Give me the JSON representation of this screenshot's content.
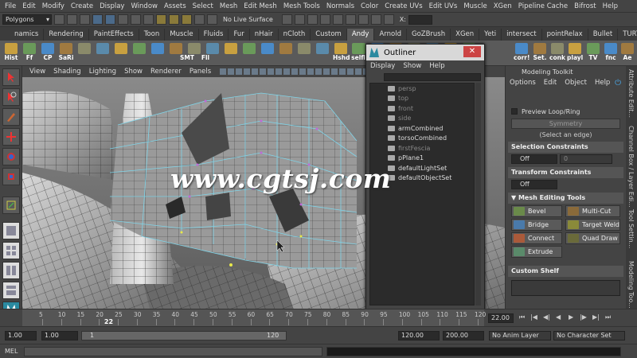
{
  "menubar": {
    "items": [
      "File",
      "Edit",
      "Modify",
      "Create",
      "Display",
      "Window",
      "Assets",
      "Select",
      "Mesh",
      "Edit Mesh",
      "Mesh Tools",
      "Normals",
      "Color",
      "Create UVs",
      "Edit UVs",
      "Muscle",
      "XGen",
      "Pipeline Cache",
      "Bifrost",
      "Help"
    ]
  },
  "statusline": {
    "mode": "Polygons",
    "live_surface": "No Live Surface",
    "x_label": "X:"
  },
  "shelf_tabs": [
    "namics",
    "Rendering",
    "PaintEffects",
    "Toon",
    "Muscle",
    "Fluids",
    "Fur",
    "nHair",
    "nCloth",
    "Custom",
    "Andy",
    "Arnold",
    "GoZBrush",
    "XGen",
    "Yeti",
    "intersect",
    "pointRelax",
    "Bullet",
    "TURTLE"
  ],
  "shelf_active_tab": "Andy",
  "shelf_tools_left": [
    "Hist",
    "Ff",
    "CP",
    "SaRi",
    "SMT",
    "Fll"
  ],
  "shelf_tools_right": [
    "Hshd",
    "selfl",
    "corr!",
    "Set.",
    "conk",
    "playl",
    "TV",
    "fnc",
    "Ae"
  ],
  "viewport": {
    "menu": [
      "View",
      "Shading",
      "Lighting",
      "Show",
      "Renderer",
      "Panels"
    ]
  },
  "outliner": {
    "title": "Outliner",
    "menu": [
      "Display",
      "Show",
      "Help"
    ],
    "items": [
      {
        "label": "persp",
        "dim": true
      },
      {
        "label": "top",
        "dim": true
      },
      {
        "label": "front",
        "dim": true
      },
      {
        "label": "side",
        "dim": true
      },
      {
        "label": "armCombined",
        "dim": false
      },
      {
        "label": "torsoCombined",
        "dim": false
      },
      {
        "label": "firstFescia",
        "dim": true
      },
      {
        "label": "pPlane1",
        "dim": false
      },
      {
        "label": "defaultLightSet",
        "dim": false
      },
      {
        "label": "defaultObjectSet",
        "dim": false
      }
    ]
  },
  "modeling_toolkit": {
    "title": "Modeling Toolkit",
    "menu": [
      "Options",
      "Edit",
      "Object",
      "Help"
    ],
    "preview_loop": "Preview Loop/Ring",
    "symmetry": "Symmetry",
    "select_hint": "(Select an edge)",
    "selection_constraints": "Selection Constraints",
    "off1": "Off",
    "off_num": "0",
    "transform_constraints": "Transform Constraints",
    "off2": "Off",
    "mesh_editing_tools": "Mesh Editing Tools",
    "tools": [
      {
        "label": "Bevel",
        "color": "#6a8a4a"
      },
      {
        "label": "Multi-Cut",
        "color": "#8a6a3a"
      },
      {
        "label": "Bridge",
        "color": "#4a7aaa"
      },
      {
        "label": "Target Weld",
        "color": "#8a8a3a"
      },
      {
        "label": "Connect",
        "color": "#aa5a3a"
      },
      {
        "label": "Quad Draw",
        "color": "#6a6a3a"
      },
      {
        "label": "Extrude",
        "color": "#5a8a6a"
      }
    ],
    "custom_shelf": "Custom Shelf"
  },
  "side_tabs": [
    "Attribute Edit...",
    "Channel Box / Layer Edi...",
    "Tool Settin...",
    "Modeling Too..."
  ],
  "timeline": {
    "ticks": [
      "5",
      "10",
      "15",
      "20",
      "25",
      "30",
      "35",
      "40",
      "45",
      "50",
      "55",
      "60",
      "65",
      "70",
      "75",
      "80",
      "85",
      "90",
      "95",
      "100",
      "105",
      "110",
      "115",
      "120"
    ],
    "current_frame": "22",
    "current_field": "22.00"
  },
  "range": {
    "start": "1.00",
    "start2": "1.00",
    "inner_start": "1",
    "inner_end": "120",
    "end": "120.00",
    "end2": "200.00",
    "anim_layer": "No Anim Layer",
    "char_set": "No Character Set"
  },
  "cmd": {
    "label": "MEL"
  },
  "watermark": "www.cgtsj.com"
}
